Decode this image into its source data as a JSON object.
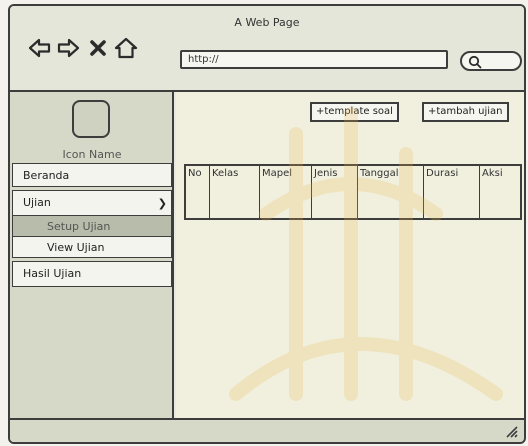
{
  "window": {
    "title": "A Web Page"
  },
  "browser": {
    "url": "http://",
    "back_icon": "arrow-left-icon",
    "forward_icon": "arrow-right-icon",
    "close_icon": "close-icon",
    "home_icon": "home-icon",
    "search_icon": "search-icon"
  },
  "sidebar": {
    "icon_label": "Icon Name",
    "menu": [
      {
        "label": "Beranda"
      },
      {
        "label": "Ujian",
        "expandable": true
      },
      {
        "label": "Setup Ujian",
        "selected": true
      },
      {
        "label": "View Ujian"
      },
      {
        "label": "Hasil Ujian"
      }
    ]
  },
  "main": {
    "buttons": {
      "template": "+template soal",
      "tambah": "+tambah ujian"
    },
    "table": {
      "headers": [
        "No",
        "Kelas",
        "Mapel",
        "Jenis",
        "Tanggal",
        "Durasi",
        "Aksi"
      ]
    }
  },
  "colors": {
    "sidebar_bg": "#d6d9c8",
    "main_bg": "#f1f0df",
    "selected_bg": "#b8bcaa",
    "watermark": "#e8c866"
  }
}
